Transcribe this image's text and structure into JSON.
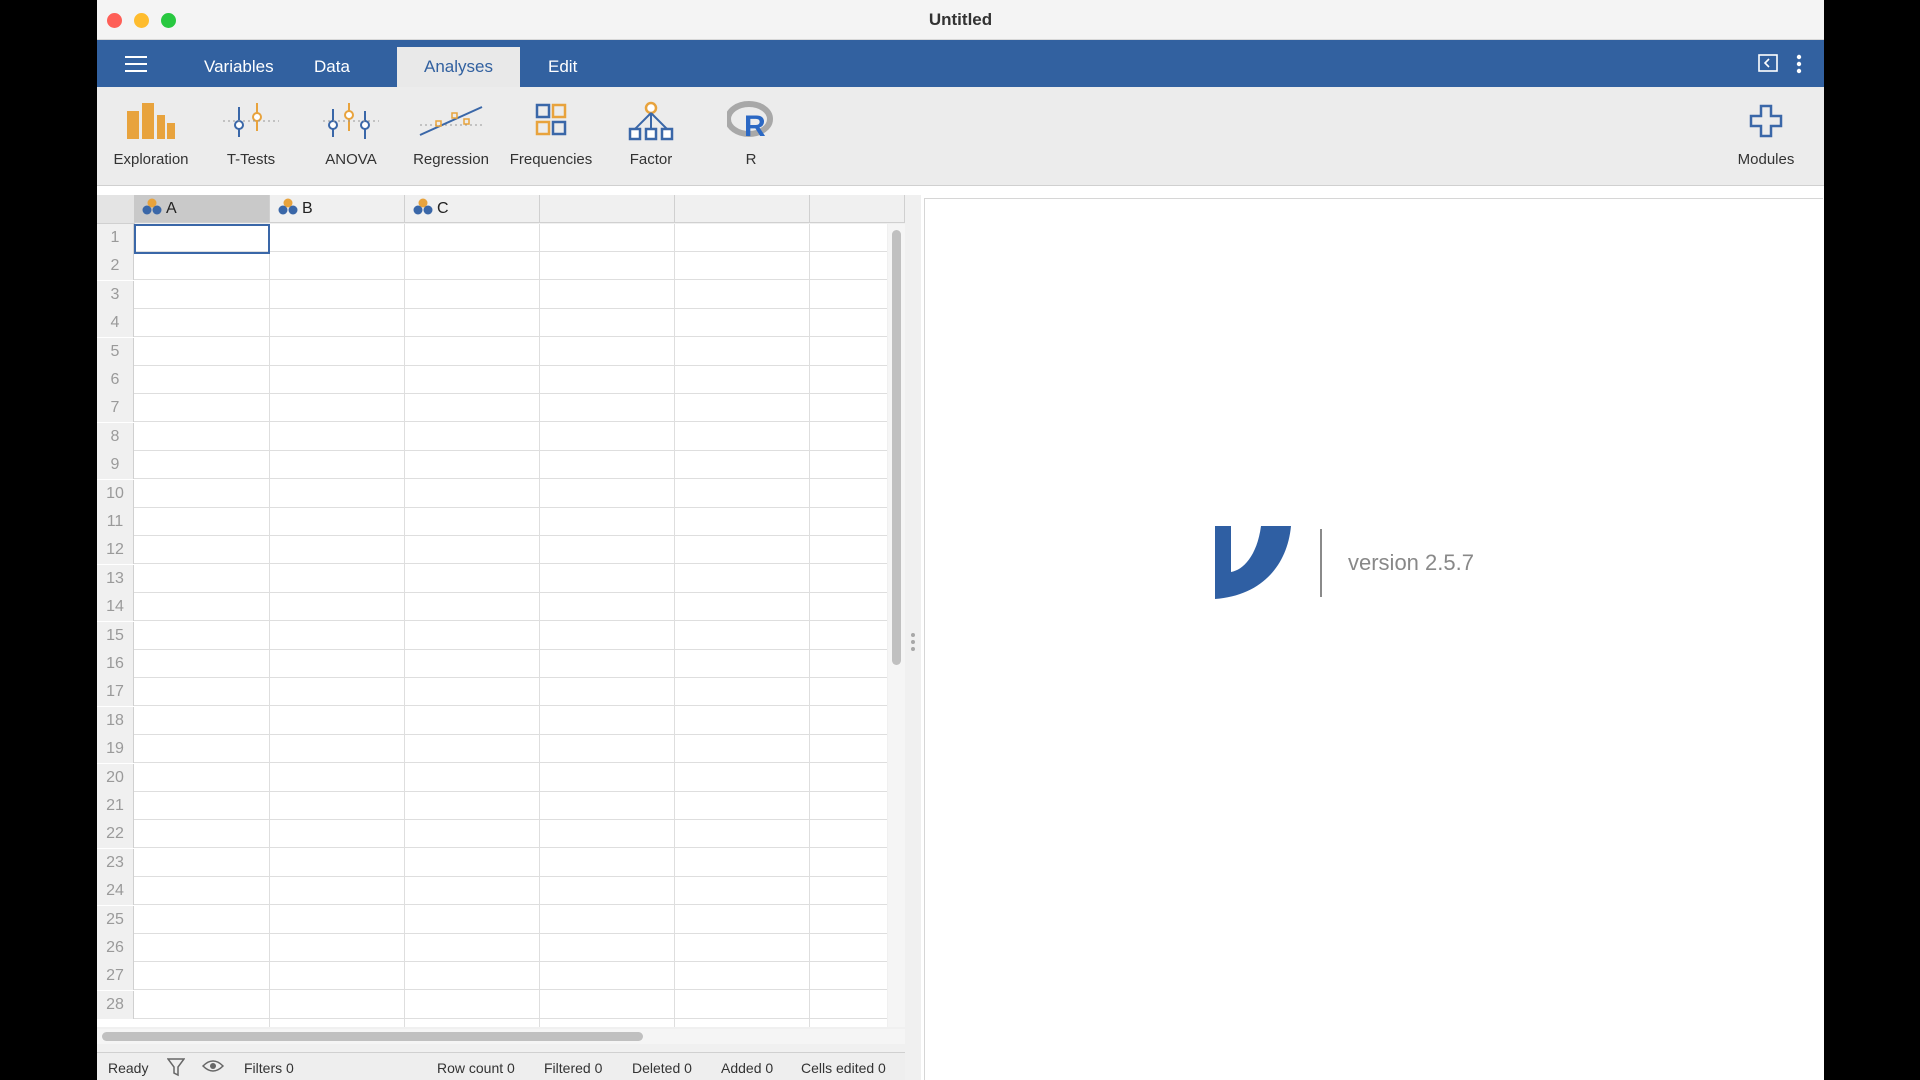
{
  "window": {
    "title": "Untitled"
  },
  "tabs": [
    {
      "label": "Variables",
      "active": false
    },
    {
      "label": "Data",
      "active": false
    },
    {
      "label": "Analyses",
      "active": true
    },
    {
      "label": "Edit",
      "active": false
    }
  ],
  "ribbon": {
    "exploration": "Exploration",
    "ttests": "T-Tests",
    "anova": "ANOVA",
    "regression": "Regression",
    "frequencies": "Frequencies",
    "factor": "Factor",
    "r": "R",
    "modules": "Modules"
  },
  "columns": [
    {
      "name": "A",
      "selected": true
    },
    {
      "name": "B",
      "selected": false
    },
    {
      "name": "C",
      "selected": false
    }
  ],
  "rows": [
    "1",
    "2",
    "3",
    "4",
    "5",
    "6",
    "7",
    "8",
    "9",
    "10",
    "11",
    "12",
    "13",
    "14",
    "15",
    "16",
    "17",
    "18",
    "19",
    "20",
    "21",
    "22",
    "23",
    "24",
    "25",
    "26",
    "27",
    "28"
  ],
  "status": {
    "ready": "Ready",
    "filters": "Filters 0",
    "row_count": "Row count 0",
    "filtered": "Filtered 0",
    "deleted": "Deleted 0",
    "added": "Added 0",
    "cells_edited": "Cells edited 0"
  },
  "results": {
    "version": "version 2.5.7"
  },
  "colors": {
    "accent": "#3261a0",
    "selection": "#3a67a8",
    "ribbon_orange": "#e8a33d"
  },
  "icons": [
    "hamburger-icon",
    "panel-toggle-icon",
    "more-vertical-icon",
    "exploration-icon",
    "ttests-icon",
    "anova-icon",
    "regression-icon",
    "frequencies-icon",
    "factor-icon",
    "r-icon",
    "modules-plus-icon",
    "nominal-variable-icon",
    "filter-icon",
    "eye-icon",
    "jamovi-logo-icon"
  ]
}
